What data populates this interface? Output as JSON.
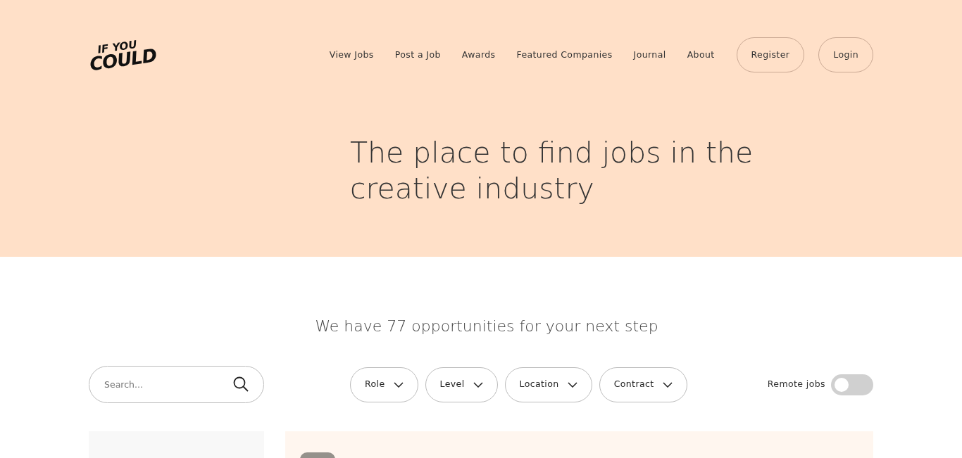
{
  "header": {
    "logo": {
      "line1": "IF YOU",
      "line2": "COULD"
    },
    "nav": [
      {
        "label": "View Jobs"
      },
      {
        "label": "Post a Job"
      },
      {
        "label": "Awards"
      },
      {
        "label": "Featured Companies"
      },
      {
        "label": "Journal"
      },
      {
        "label": "About"
      }
    ],
    "buttons": [
      {
        "label": "Register"
      },
      {
        "label": "Login"
      }
    ]
  },
  "hero": {
    "title": "The place to find jobs in the creative industry"
  },
  "jobs": {
    "count_text": "We have 77 opportunities for your next step",
    "search": {
      "placeholder": "Search..."
    },
    "filters": [
      {
        "label": "Role"
      },
      {
        "label": "Level"
      },
      {
        "label": "Location"
      },
      {
        "label": "Contract"
      }
    ],
    "remote_toggle": {
      "label": "Remote jobs",
      "on": false
    }
  }
}
